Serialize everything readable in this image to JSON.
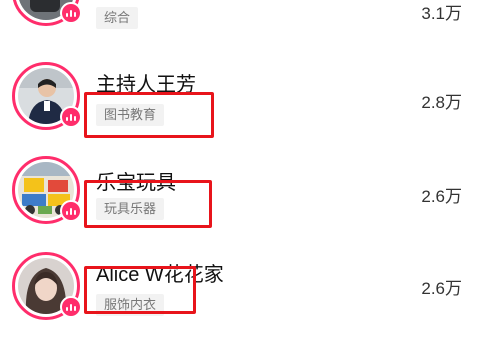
{
  "rows": [
    {
      "name": "",
      "tag": "综合",
      "count": "3.1万"
    },
    {
      "name": "主持人王芳",
      "tag": "图书教育",
      "count": "2.8万"
    },
    {
      "name": "乐宝玩具",
      "tag": "玩具乐器",
      "count": "2.6万"
    },
    {
      "name": "Alice W花花家",
      "tag": "服饰内衣",
      "count": "2.6万"
    }
  ],
  "colors": {
    "ring": "#ff2d6b",
    "highlight": "#e8141b",
    "tag_bg": "#f2f2f2"
  },
  "icons": {
    "live": "live-bars-icon"
  }
}
